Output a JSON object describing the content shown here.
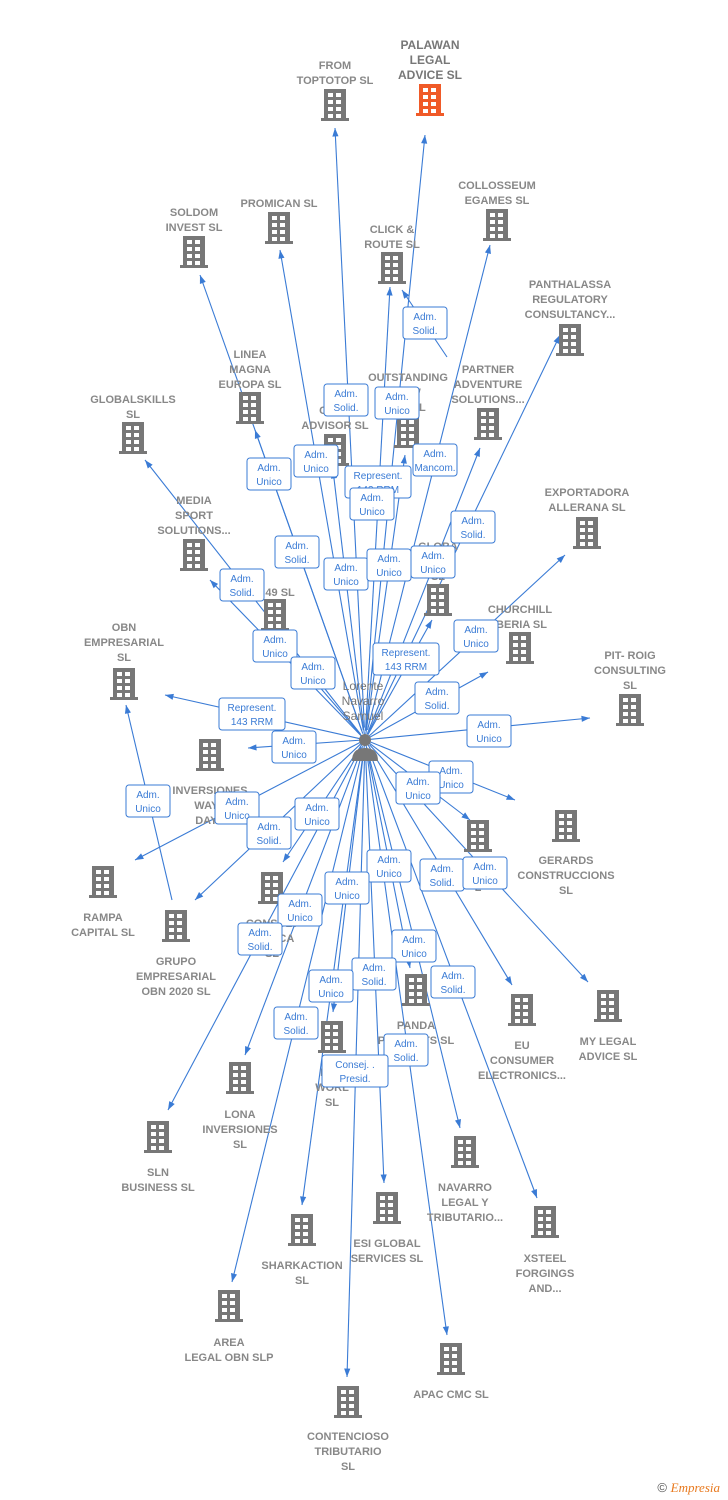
{
  "center": {
    "label": [
      "Lorente",
      "Navarro",
      "Samuel"
    ],
    "icon": "person-icon"
  },
  "colors": {
    "edge": "#3a7bd5",
    "node": "#777777",
    "highlight": "#f05a28"
  },
  "nodes": [
    {
      "label": [
        "FROM",
        "TOPTOTOP  SL"
      ]
    },
    {
      "label": [
        "PALAWAN",
        "LEGAL",
        "ADVICE  SL"
      ],
      "highlight": true
    },
    {
      "label": [
        "COLLOSSEUM",
        "EGAMES  SL"
      ]
    },
    {
      "label": [
        "SOLDOM",
        "INVEST  SL"
      ]
    },
    {
      "label": [
        "PROMICAN  SL"
      ]
    },
    {
      "label": [
        "CLICK &",
        "ROUTE  SL"
      ]
    },
    {
      "label": [
        "PANTHALASSA",
        "REGULATORY",
        "CONSULTANCY..."
      ]
    },
    {
      "label": [
        "LINEA",
        "MAGNA",
        "EUROPA  SL"
      ]
    },
    {
      "label": [
        "GLOBALSKILLS",
        "SL"
      ]
    },
    {
      "label": [
        "S",
        "CORP",
        "ADVISOR  SL"
      ]
    },
    {
      "label": [
        "OUTSTANDING",
        "NEW",
        "B        S  SL"
      ]
    },
    {
      "label": [
        "PARTNER",
        "ADVENTURE",
        "SOLUTIONS..."
      ]
    },
    {
      "label": [
        "MEDIA",
        "SPORT",
        "SOLUTIONS..."
      ]
    },
    {
      "label": [
        "EXPORTADORA",
        "ALLERANA  SL"
      ]
    },
    {
      "label": [
        "GLOBA",
        "E",
        "SL"
      ]
    },
    {
      "label": [
        "P 49 SL"
      ]
    },
    {
      "label": [
        "CHURCHILL",
        "IBERIA  SL"
      ]
    },
    {
      "label": [
        "OBN",
        "EMPRESARIAL",
        "SL"
      ]
    },
    {
      "label": [
        "PIT- ROIG",
        "CONSULTING",
        "SL"
      ]
    },
    {
      "label": [
        "INVERSIONES",
        "WAYS",
        "DAYS"
      ]
    },
    {
      "label": [
        "GERARDS",
        "CONSTRUCCIONS",
        "SL"
      ]
    },
    {
      "label": [
        "L"
      ]
    },
    {
      "label": [
        "RAMPA",
        "CAPITAL  SL"
      ]
    },
    {
      "label": [
        "GRUPO",
        "EMPRESARIAL",
        "OBN 2020  SL"
      ]
    },
    {
      "label": [
        "CONSULT",
        "TE      GICA",
        "SL"
      ]
    },
    {
      "label": [
        "EU",
        "CONSUMER",
        "ELECTRONICS..."
      ]
    },
    {
      "label": [
        "MY LEGAL",
        "ADVICE  SL"
      ]
    },
    {
      "label": [
        "PANDA",
        "PROJECTS  SL"
      ]
    },
    {
      "label": [
        "BEG",
        "WORL",
        "SL"
      ]
    },
    {
      "label": [
        "LONA",
        "INVERSIONES",
        "SL"
      ]
    },
    {
      "label": [
        "SLN",
        "BUSINESS  SL"
      ]
    },
    {
      "label": [
        "NAVARRO",
        "LEGAL Y",
        "TRIBUTARIO..."
      ]
    },
    {
      "label": [
        "XSTEEL",
        "FORGINGS",
        "AND..."
      ]
    },
    {
      "label": [
        "SHARKACTION",
        "SL"
      ]
    },
    {
      "label": [
        "ESI GLOBAL",
        "SERVICES  SL"
      ]
    },
    {
      "label": [
        "AREA",
        "LEGAL OBN  SLP"
      ]
    },
    {
      "label": [
        "APAC CMC  SL"
      ]
    },
    {
      "label": [
        "CONTENCIOSO",
        "TRIBUTARIO",
        "SL"
      ]
    }
  ],
  "edge_labels": [
    {
      "lines": [
        "Adm.",
        "Solid."
      ]
    },
    {
      "lines": [
        "Adm.",
        "Solid."
      ]
    },
    {
      "lines": [
        "Adm.",
        "Unico"
      ]
    },
    {
      "lines": [
        "Adm.",
        "Unico"
      ]
    },
    {
      "lines": [
        "Adm.",
        "Unico"
      ]
    },
    {
      "lines": [
        "Represent.",
        "143 RRM"
      ]
    },
    {
      "lines": [
        "Adm.",
        "Mancom."
      ]
    },
    {
      "lines": [
        "Adm.",
        "Unico"
      ]
    },
    {
      "lines": [
        "Adm.",
        "Solid."
      ]
    },
    {
      "lines": [
        "Adm.",
        "Solid."
      ]
    },
    {
      "lines": [
        "Adm.",
        "Unico"
      ]
    },
    {
      "lines": [
        "Adm.",
        "Unico"
      ]
    },
    {
      "lines": [
        "Adm.",
        "Unico"
      ]
    },
    {
      "lines": [
        "Adm.",
        "Solid."
      ]
    },
    {
      "lines": [
        "Adm.",
        "Unico"
      ]
    },
    {
      "lines": [
        "Adm.",
        "Unico"
      ]
    },
    {
      "lines": [
        "Adm.",
        "Unico"
      ]
    },
    {
      "lines": [
        "Represent.",
        "143 RRM"
      ]
    },
    {
      "lines": [
        "Represent.",
        "143 RRM"
      ]
    },
    {
      "lines": [
        "Adm.",
        "Solid."
      ]
    },
    {
      "lines": [
        "Adm.",
        "Unico"
      ]
    },
    {
      "lines": [
        "Adm.",
        "Unico"
      ]
    },
    {
      "lines": [
        "Adm.",
        "Unico"
      ]
    },
    {
      "lines": [
        "Adm.",
        "Unico"
      ]
    },
    {
      "lines": [
        "Adm.",
        "Solid."
      ]
    },
    {
      "lines": [
        "Adm.",
        "Unico"
      ]
    },
    {
      "lines": [
        "Adm.",
        "Unico"
      ]
    },
    {
      "lines": [
        "Adm.",
        "Unico"
      ]
    },
    {
      "lines": [
        "Adm.",
        "Unico"
      ]
    },
    {
      "lines": [
        "Adm.",
        "Unico"
      ]
    },
    {
      "lines": [
        "Adm.",
        "Solid."
      ]
    },
    {
      "lines": [
        "Adm.",
        "Unico"
      ]
    },
    {
      "lines": [
        "Adm.",
        "Unico"
      ]
    },
    {
      "lines": [
        "Adm.",
        "Solid."
      ]
    },
    {
      "lines": [
        "Adm.",
        "Unico"
      ]
    },
    {
      "lines": [
        "Adm.",
        "Solid."
      ]
    },
    {
      "lines": [
        "Adm.",
        "Unico"
      ]
    },
    {
      "lines": [
        "Adm.",
        "Solid."
      ]
    },
    {
      "lines": [
        "Adm.",
        "Solid."
      ]
    },
    {
      "lines": [
        "Adm.",
        "Solid."
      ]
    },
    {
      "lines": [
        "Consej. .",
        "Presid."
      ]
    }
  ],
  "footer": {
    "copyright": "©",
    "brand": "Empresia"
  }
}
